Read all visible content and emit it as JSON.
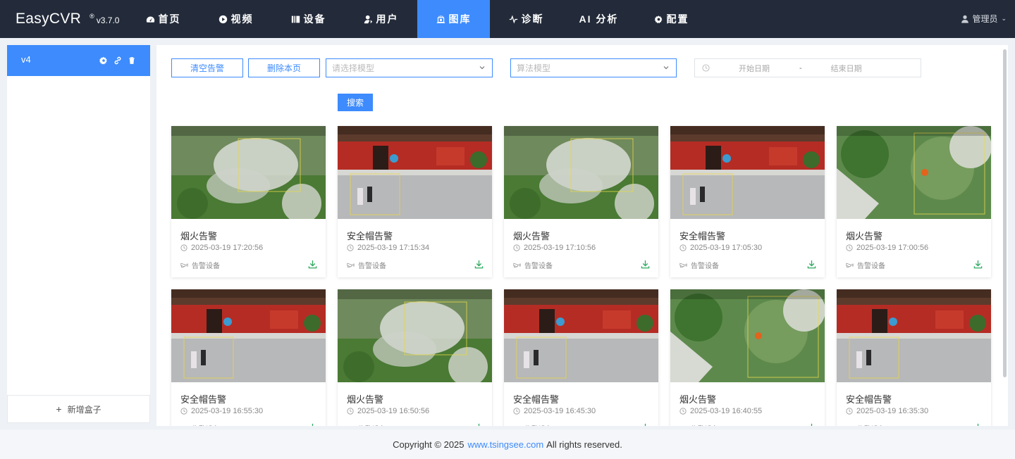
{
  "app": {
    "name": "EasyCVR",
    "reg": "®",
    "version": "v3.7.0"
  },
  "nav": [
    {
      "label": "首页",
      "icon": "dashboard-icon",
      "active": false
    },
    {
      "label": "视频",
      "icon": "play-icon",
      "active": false
    },
    {
      "label": "设备",
      "icon": "device-icon",
      "active": false
    },
    {
      "label": "用户",
      "icon": "user-icon",
      "active": false
    },
    {
      "label": "图库",
      "icon": "gallery-icon",
      "active": true
    },
    {
      "label": "诊断",
      "icon": "pulse-icon",
      "active": false
    },
    {
      "label": "AI 分析",
      "icon": "ai-icon",
      "active": false
    },
    {
      "label": "配置",
      "icon": "gear-icon",
      "active": false
    }
  ],
  "user": {
    "label": "管理员"
  },
  "sidebar": {
    "box": {
      "name": "v4"
    },
    "add_label": "新增盒子",
    "add_plus": "+"
  },
  "toolbar": {
    "clear_label": "清空告警",
    "delete_label": "删除本页",
    "model_placeholder": "请选择模型",
    "algo_placeholder": "算法模型",
    "start_placeholder": "开始日期",
    "range_sep": "-",
    "end_placeholder": "结束日期",
    "search_label": "搜索"
  },
  "cards": [
    {
      "title": "烟火告警",
      "time": "2025-03-19 17:20:56",
      "device": "告警设备",
      "scene": "smoke"
    },
    {
      "title": "安全帽告警",
      "time": "2025-03-19 17:15:34",
      "device": "告警设备",
      "scene": "temple"
    },
    {
      "title": "烟火告警",
      "time": "2025-03-19 17:10:56",
      "device": "告警设备",
      "scene": "smoke"
    },
    {
      "title": "安全帽告警",
      "time": "2025-03-19 17:05:30",
      "device": "告警设备",
      "scene": "temple"
    },
    {
      "title": "烟火告警",
      "time": "2025-03-19 17:00:56",
      "device": "告警设备",
      "scene": "forest"
    },
    {
      "title": "安全帽告警",
      "time": "2025-03-19 16:55:30",
      "device": "告警设备",
      "scene": "temple"
    },
    {
      "title": "烟火告警",
      "time": "2025-03-19 16:50:56",
      "device": "告警设备",
      "scene": "smoke"
    },
    {
      "title": "安全帽告警",
      "time": "2025-03-19 16:45:30",
      "device": "告警设备",
      "scene": "temple"
    },
    {
      "title": "烟火告警",
      "time": "2025-03-19 16:40:55",
      "device": "告警设备",
      "scene": "forest"
    },
    {
      "title": "安全帽告警",
      "time": "2025-03-19 16:35:30",
      "device": "告警设备",
      "scene": "temple"
    }
  ],
  "footer": {
    "prefix": "Copyright © 2025",
    "link": "www.tsingsee.com",
    "suffix": "All rights reserved."
  },
  "colors": {
    "accent": "#3d8bfd",
    "topbar": "#232b3a",
    "download": "#2daa5f"
  }
}
